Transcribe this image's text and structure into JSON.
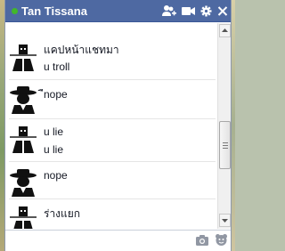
{
  "window": {
    "contact_name": "Tan Tissana",
    "status": "online",
    "accent_color": "#4e69a2",
    "online_color": "#42b72a"
  },
  "titlebar_icons": [
    "add-friend-icon",
    "video-call-icon",
    "settings-icon",
    "close-icon"
  ],
  "messages": [
    {
      "avatar": "avatar-square-face",
      "lines": [
        "แคปหน้าแชทมา",
        "u troll"
      ]
    },
    {
      "avatar": "avatar-hat-silhouette",
      "lines": [
        "ืnope"
      ]
    },
    {
      "avatar": "avatar-square-face",
      "lines": [
        "u lie",
        "u lie"
      ]
    },
    {
      "avatar": "avatar-hat-silhouette",
      "lines": [
        "nope"
      ]
    },
    {
      "avatar": "avatar-square-face",
      "lines": [
        "ร่างแยก"
      ]
    }
  ],
  "composer": {
    "placeholder": "",
    "icons": [
      "camera-icon",
      "sticker-icon"
    ]
  }
}
